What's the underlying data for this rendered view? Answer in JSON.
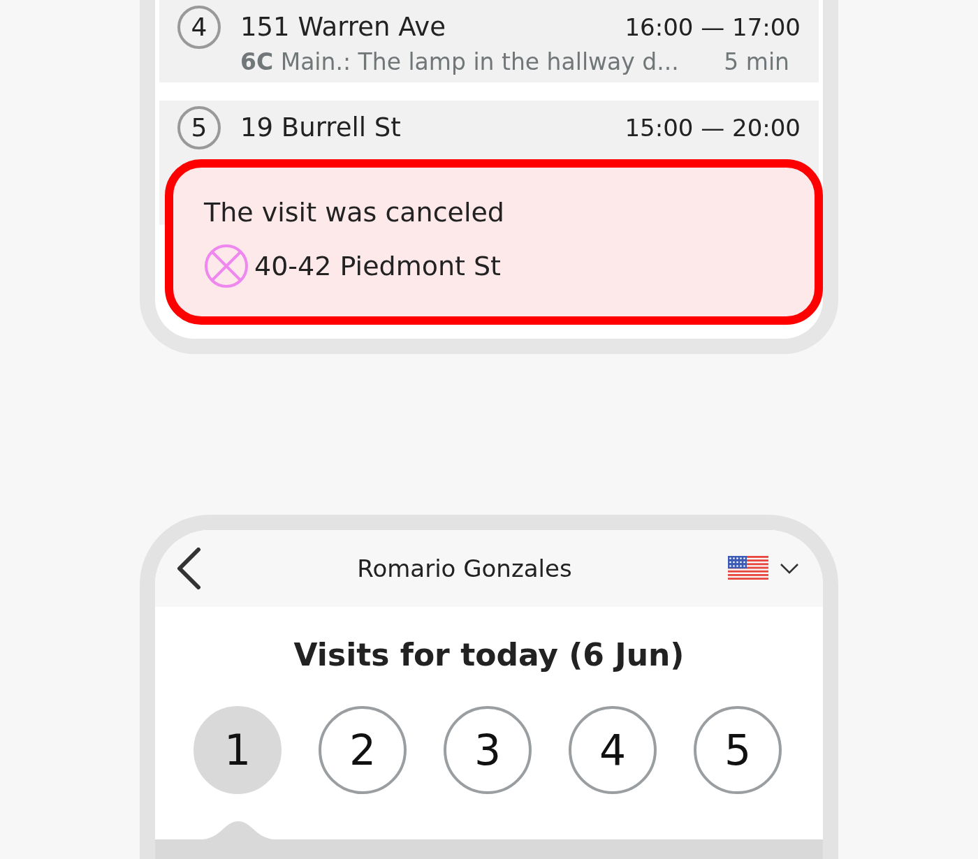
{
  "visit_list": [
    {
      "number": "4",
      "address": "151 Warren Ave",
      "time": "16:00 — 17:00",
      "note": "**6C** Main.: The lamp in the hallway d...",
      "duration": "5 min"
    },
    {
      "number": "5",
      "address": "19 Burrell St",
      "time": "15:00 — 20:00"
    }
  ],
  "callout": {
    "title": "The visit was canceled",
    "address": "40-42 Piedmont St"
  },
  "header": {
    "title": "Romario Gonzales"
  },
  "heading": "Visits for today (6 Jun)",
  "visit_tabs": [
    {
      "label": "1",
      "selected": true
    },
    {
      "label": "2",
      "selected": false
    },
    {
      "label": "3",
      "selected": false
    },
    {
      "label": "4",
      "selected": false
    },
    {
      "label": "5",
      "selected": false
    }
  ]
}
